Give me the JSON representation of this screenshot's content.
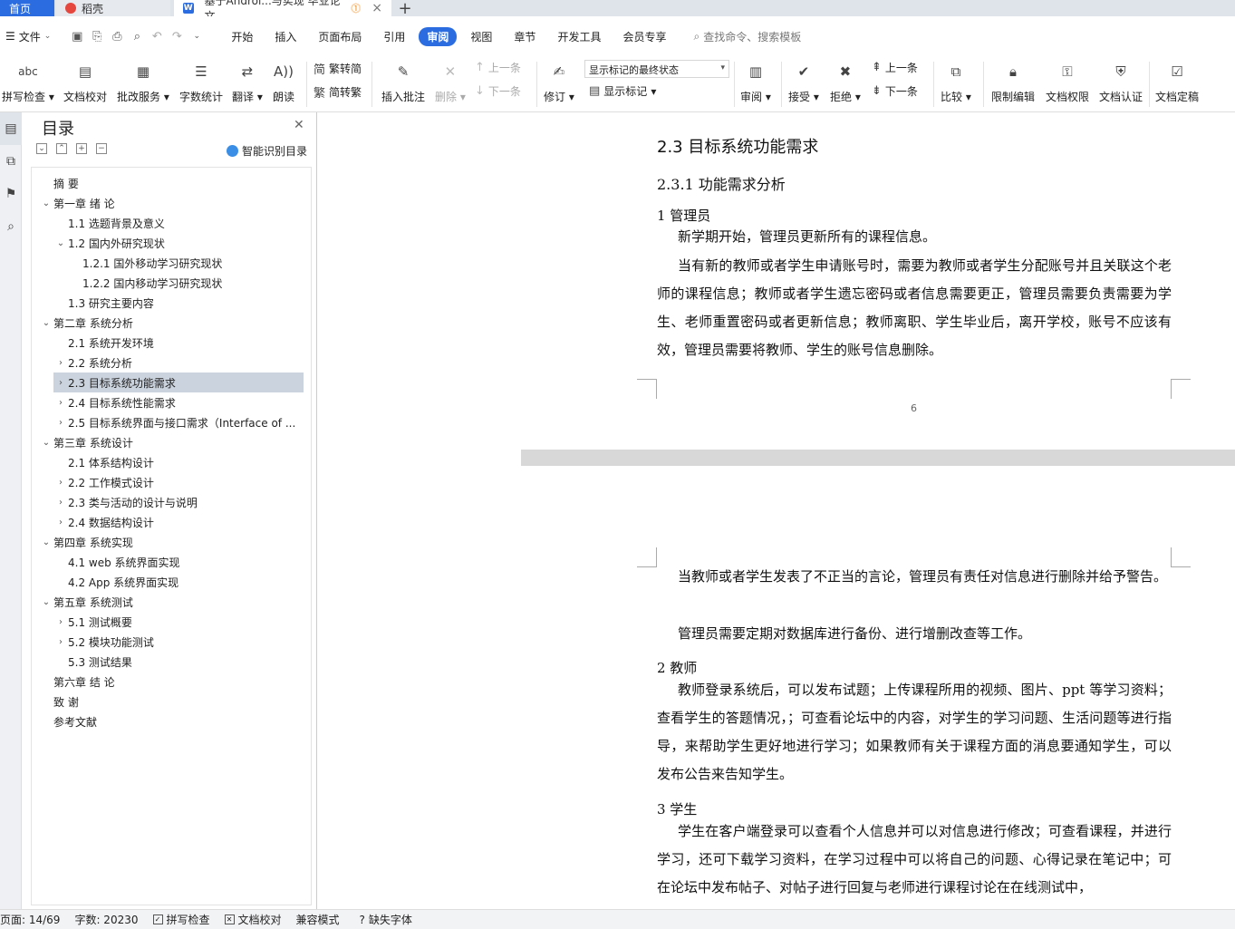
{
  "tabs": {
    "home": "首页",
    "daoke": "稻壳",
    "doc": "基于Androi...与实现 毕业论文"
  },
  "menu": {
    "file": "文件",
    "items": [
      "开始",
      "插入",
      "页面布局",
      "引用",
      "审阅",
      "视图",
      "章节",
      "开发工具",
      "会员专享"
    ],
    "active": "审阅",
    "search_placeholder": "查找命令、搜索模板"
  },
  "ribbon": {
    "spell": "拼写检查",
    "proof": "文档校对",
    "batch": "批改服务",
    "wordcount": "字数统计",
    "translate": "翻译",
    "read": "朗读",
    "to_simplified": "繁转简",
    "to_traditional": "简转繁",
    "insert_comment": "插入批注",
    "delete": "删除",
    "prev_comment": "上一条",
    "next_comment": "下一条",
    "revise": "修订",
    "markup_state": "显示标记的最终状态",
    "show_markup": "显示标记",
    "review": "审阅",
    "accept": "接受",
    "reject": "拒绝",
    "prev_change": "上一条",
    "next_change": "下一条",
    "compare": "比较",
    "restrict_edit": "限制编辑",
    "doc_permission": "文档权限",
    "doc_cert": "文档认证",
    "doc_final": "文档定稿"
  },
  "toc": {
    "title": "目录",
    "ai_label": "智能识别目录",
    "items": [
      {
        "text": "摘  要",
        "arrow": ""
      },
      {
        "text": "第一章  绪  论",
        "arrow": "v"
      },
      {
        "text": "1.1 选题背景及意义",
        "arrow": ""
      },
      {
        "text": "1.2 国内外研究现状",
        "arrow": "v"
      },
      {
        "text": "1.2.1 国外移动学习研究现状",
        "arrow": ""
      },
      {
        "text": "1.2.2 国内移动学习研究现状",
        "arrow": ""
      },
      {
        "text": "1.3 研究主要内容",
        "arrow": ""
      },
      {
        "text": "第二章  系统分析",
        "arrow": "v"
      },
      {
        "text": "2.1 系统开发环境",
        "arrow": ""
      },
      {
        "text": "2.2 系统分析",
        "arrow": ">"
      },
      {
        "text": "2.3 目标系统功能需求",
        "arrow": ">"
      },
      {
        "text": "2.4 目标系统性能需求",
        "arrow": ">"
      },
      {
        "text": "2.5 目标系统界面与接口需求（Interface of ...",
        "arrow": ">"
      },
      {
        "text": "第三章  系统设计",
        "arrow": "v"
      },
      {
        "text": "2.1  体系结构设计",
        "arrow": ""
      },
      {
        "text": "2.2  工作模式设计",
        "arrow": ">"
      },
      {
        "text": "2.3 类与活动的设计与说明",
        "arrow": ">"
      },
      {
        "text": "2.4 数据结构设计",
        "arrow": ">"
      },
      {
        "text": "第四章  系统实现",
        "arrow": "v"
      },
      {
        "text": "4.1 web 系统界面实现",
        "arrow": ""
      },
      {
        "text": "4.2 App 系统界面实现",
        "arrow": ""
      },
      {
        "text": "第五章  系统测试",
        "arrow": "v"
      },
      {
        "text": "5.1 测试概要",
        "arrow": ">"
      },
      {
        "text": "5.2 模块功能测试",
        "arrow": ">"
      },
      {
        "text": "5.3  测试结果",
        "arrow": ""
      },
      {
        "text": "第六章  结  论",
        "arrow": ""
      },
      {
        "text": "致  谢",
        "arrow": ""
      },
      {
        "text": "参考文献",
        "arrow": ""
      }
    ],
    "selected": "2.3 目标系统功能需求"
  },
  "document": {
    "h2": "2.3 目标系统功能需求",
    "h3": "2.3.1 功能需求分析",
    "admin_heading": "1 管理员",
    "admin_p1": "新学期开始，管理员更新所有的课程信息。",
    "admin_p2": "当有新的教师或者学生申请账号时，需要为教师或者学生分配账号并且关联这个老师的课程信息；教师或者学生遗忘密码或者信息需要更正，管理员需要负责需要为学生、老师重置密码或者更新信息；教师离职、学生毕业后，离开学校，账号不应该有效，管理员需要将教师、学生的账号信息删除。",
    "page_number": "6",
    "admin_p3": "当教师或者学生发表了不正当的言论，管理员有责任对信息进行删除并给予警告。",
    "admin_p4": "管理员需要定期对数据库进行备份、进行增删改查等工作。",
    "teacher_heading": "2 教师",
    "teacher_p1": "教师登录系统后，可以发布试题；上传课程所用的视频、图片、ppt 等学习资料；查看学生的答题情况，；可查看论坛中的内容，对学生的学习问题、生活问题等进行指导，来帮助学生更好地进行学习；如果教师有关于课程方面的消息要通知学生，可以发布公告来告知学生。",
    "student_heading": "3 学生",
    "student_p1": "学生在客户端登录可以查看个人信息并可以对信息进行修改；可查看课程，并进行学习，还可下载学习资料，在学习过程中可以将自己的问题、心得记录在笔记中；可在论坛中发布帖子、对帖子进行回复与老师进行课程讨论在在线测试中，"
  },
  "status": {
    "page": "页面: 14/69",
    "words": "字数: 20230",
    "spell": "拼写检查",
    "proof": "文档校对",
    "compat": "兼容模式",
    "missing_font": "缺失字体"
  }
}
